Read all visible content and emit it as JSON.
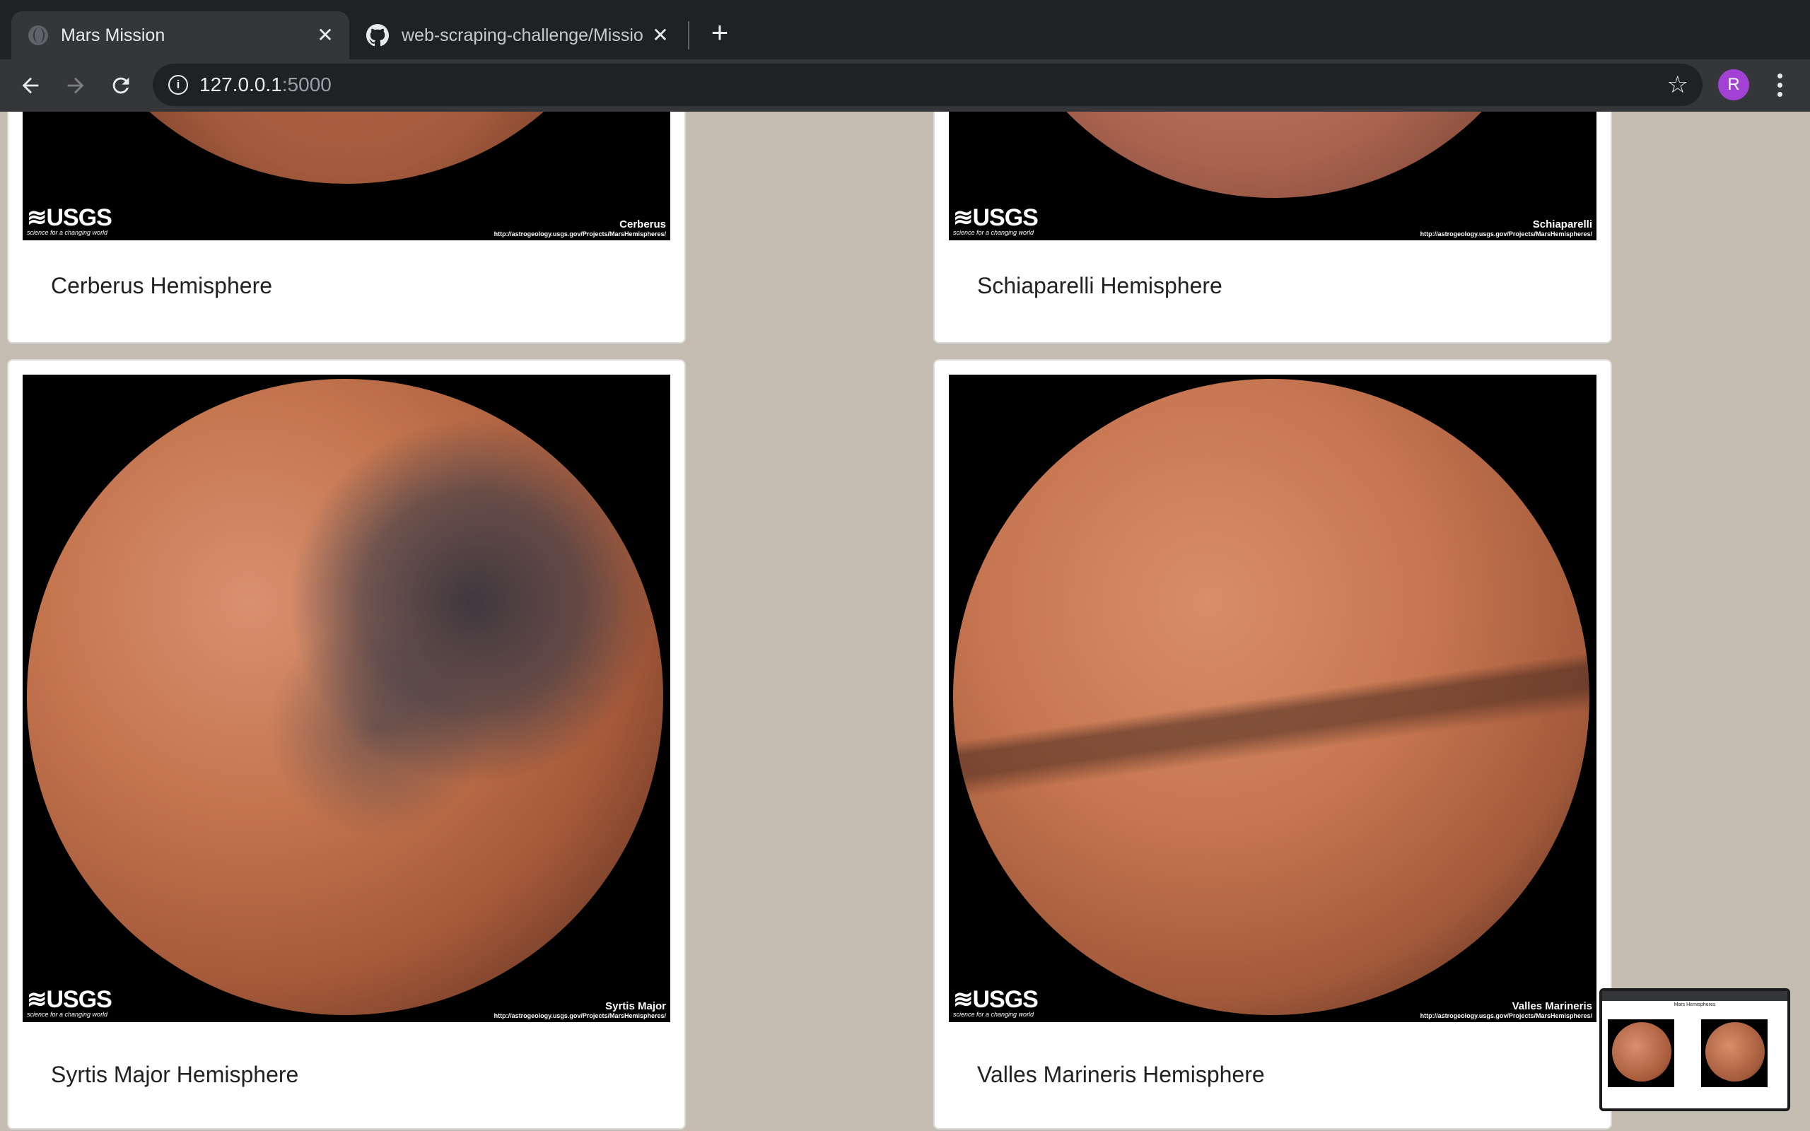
{
  "browser": {
    "tabs": [
      {
        "title": "Mars Mission",
        "active": true
      },
      {
        "title": "web-scraping-challenge/Missio",
        "active": false
      }
    ],
    "url_host": "127.0.0.1",
    "url_port": ":5000"
  },
  "profile": {
    "initial": "R"
  },
  "hemispheres": [
    {
      "title": "Cerberus Hemisphere",
      "image_label": "Cerberus"
    },
    {
      "title": "Schiaparelli Hemisphere",
      "image_label": "Schiaparelli"
    },
    {
      "title": "Syrtis Major Hemisphere",
      "image_label": "Syrtis Major"
    },
    {
      "title": "Valles Marineris Hemisphere",
      "image_label": "Valles Marineris"
    }
  ],
  "image_credit": {
    "logo": "USGS",
    "tagline": "science for a changing world",
    "source": "http://astrogeology.usgs.gov/Projects/MarsHemispheres/"
  },
  "preview": {
    "title": "Mars Hemispheres"
  },
  "colors": {
    "mars_orange": "#c9714a",
    "mars_dark": "#3a3c48",
    "page_bg": "#c4bbb1"
  }
}
